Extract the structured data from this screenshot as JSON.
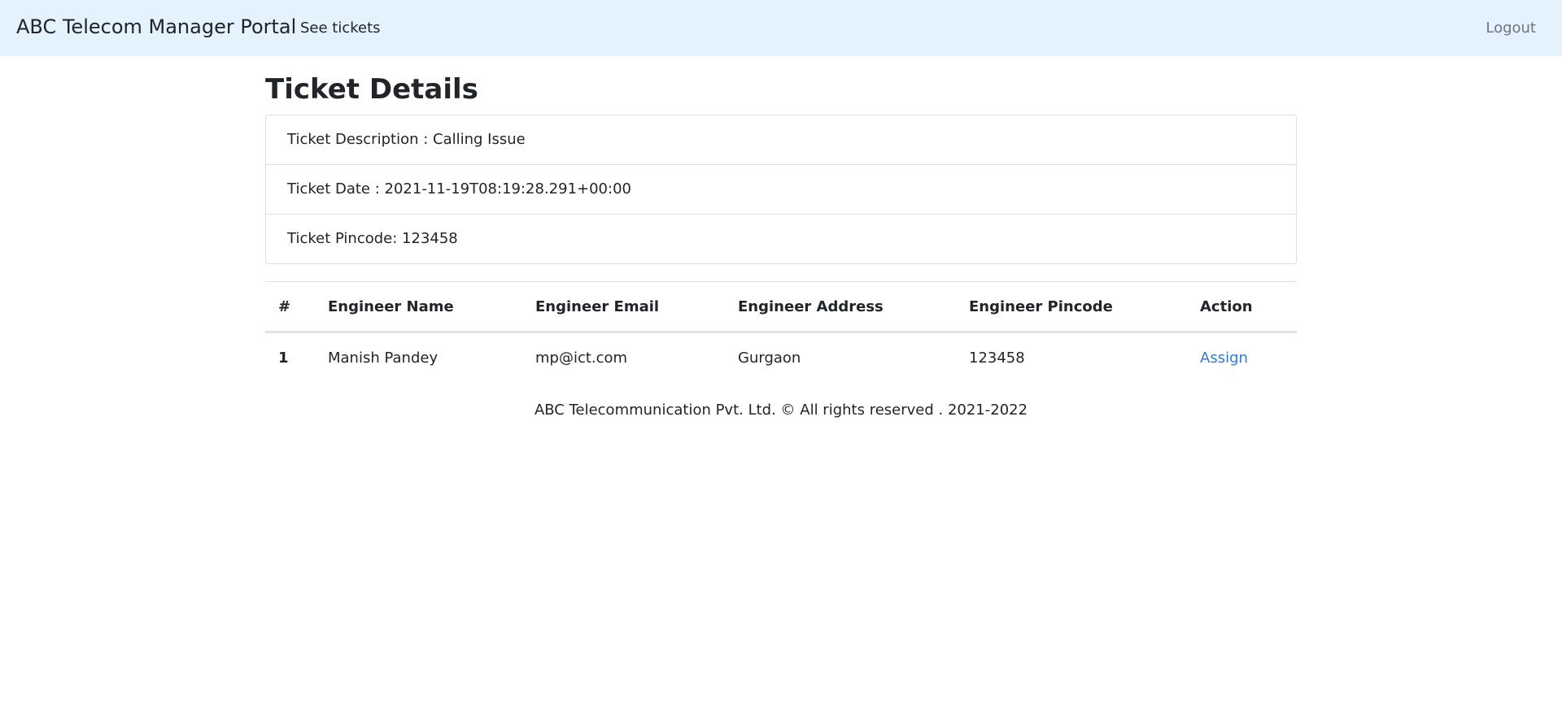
{
  "navbar": {
    "brand": "ABC Telecom Manager Portal",
    "see_tickets": "See tickets",
    "logout": "Logout"
  },
  "page": {
    "title": "Ticket Details"
  },
  "ticket": {
    "description": "Ticket Description : Calling Issue",
    "date": "Ticket Date : 2021-11-19T08:19:28.291+00:00",
    "pincode": "Ticket Pincode: 123458"
  },
  "table": {
    "headers": [
      "#",
      "Engineer Name",
      "Engineer Email",
      "Engineer Address",
      "Engineer Pincode",
      "Action"
    ],
    "rows": [
      {
        "num": "1",
        "name": "Manish Pandey",
        "email": "mp@ict.com",
        "address": "Gurgaon",
        "pincode": "123458",
        "action": "Assign"
      }
    ]
  },
  "footer": {
    "text": "ABC Telecommunication Pvt. Ltd. © All rights reserved . 2021-2022"
  },
  "colors": {
    "navbar_bg": "#e3f2fd",
    "link": "#2f7bd9",
    "logout": "#6c757d"
  }
}
